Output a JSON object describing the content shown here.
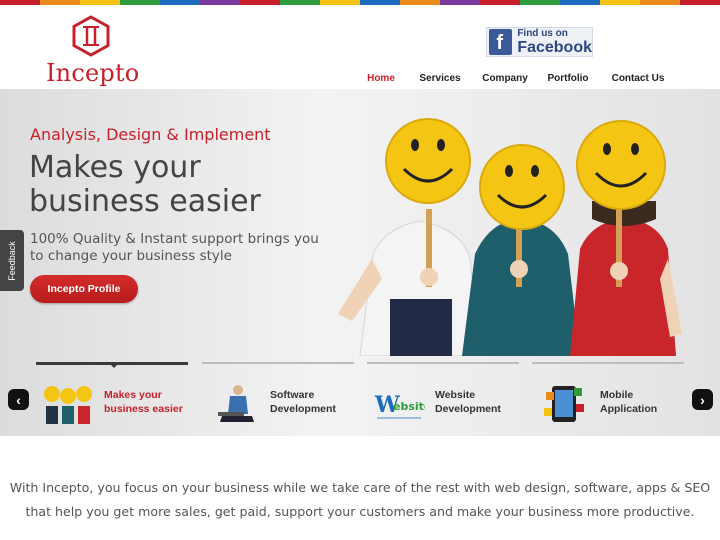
{
  "colors": {
    "brand_red": "#c8202a",
    "strip": [
      "#c8202a",
      "#e98a1a",
      "#f2c315",
      "#2f9c3b",
      "#1c6cbf",
      "#7a3a9c",
      "#c8202a",
      "#2f9c3b",
      "#f2c315",
      "#1c6cbf",
      "#e98a1a",
      "#7a3a9c",
      "#c8202a",
      "#2f9c3b",
      "#1c6cbf",
      "#f2c315",
      "#e98a1a",
      "#c8202a"
    ]
  },
  "header": {
    "logo_text": "Incepto",
    "facebook": {
      "small": "Find us on",
      "big": "Facebook",
      "icon": "facebook-icon"
    },
    "nav": [
      {
        "label": "Home",
        "active": true
      },
      {
        "label": "Services",
        "active": false
      },
      {
        "label": "Company",
        "active": false
      },
      {
        "label": "Portfolio",
        "active": false
      },
      {
        "label": "Contact Us",
        "active": false
      }
    ]
  },
  "hero": {
    "tagline": "Analysis, Design & Implement",
    "headline_line1": "Makes your",
    "headline_line2": "business easier",
    "sub_line1": "100% Quality & Instant support brings you",
    "sub_line2": "to change your business style",
    "button": "Incepto Profile",
    "feedback": "Feedback"
  },
  "slider": {
    "prev_icon": "chevron-left-icon",
    "next_icon": "chevron-right-icon",
    "items": [
      {
        "line1": "Makes your",
        "line2": "business easier",
        "icon": "smiley-people-icon",
        "active": true
      },
      {
        "line1": "Software",
        "line2": "Development",
        "icon": "developer-laptop-icon",
        "active": false
      },
      {
        "line1": "Website",
        "line2": "Development",
        "icon": "website-text-icon",
        "active": false
      },
      {
        "line1": "Mobile",
        "line2": "Application",
        "icon": "smartphone-apps-icon",
        "active": false
      }
    ]
  },
  "intro": {
    "line1": "With Incepto, you focus on your business while we take care of the rest with web design, software, apps & SEO",
    "line2": "that help you get more sales, get paid, support your customers and make your business more productive."
  }
}
